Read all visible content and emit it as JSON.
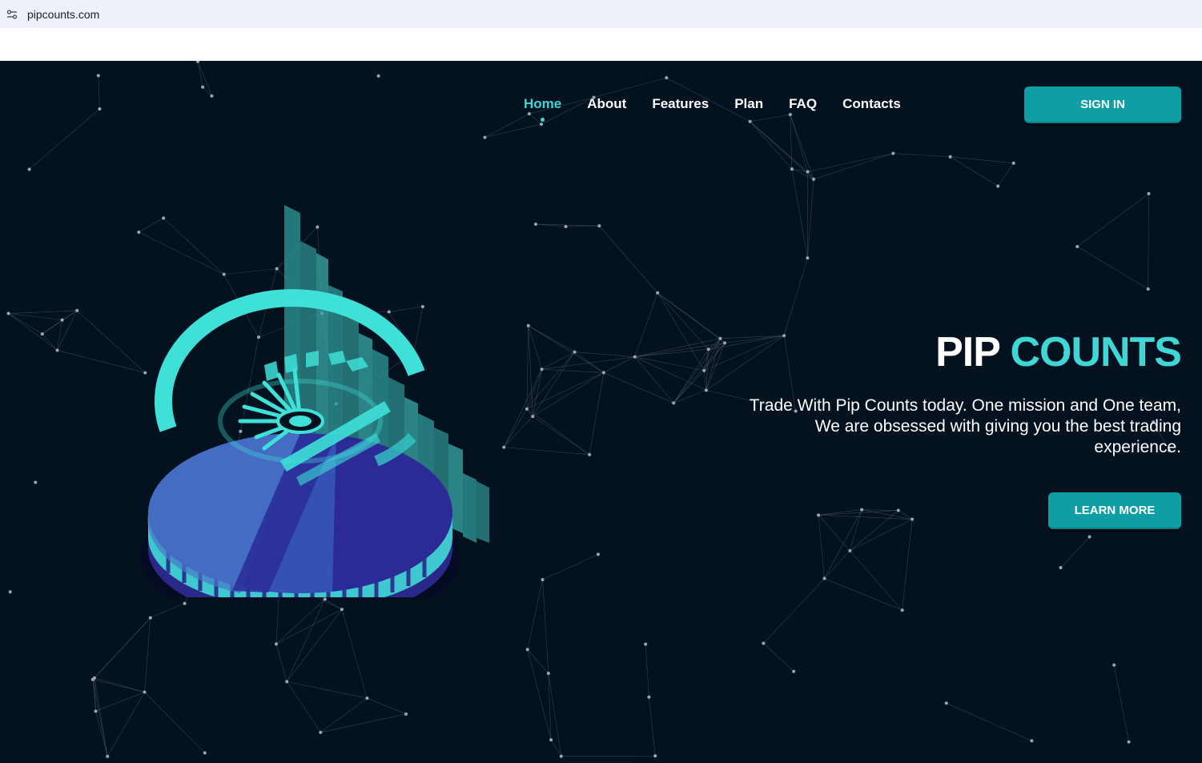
{
  "browser": {
    "url": "pipcounts.com"
  },
  "nav": {
    "items": [
      {
        "label": "Home",
        "active": true
      },
      {
        "label": "About",
        "active": false
      },
      {
        "label": "Features",
        "active": false
      },
      {
        "label": "Plan",
        "active": false
      },
      {
        "label": "FAQ",
        "active": false
      },
      {
        "label": "Contacts",
        "active": false
      }
    ],
    "sign_in_label": "SIGN IN"
  },
  "hero": {
    "title_white": "PIP",
    "title_accent": "COUNTS",
    "tagline": "Trade With Pip Counts today. One mission and One team, We are obsessed with giving you the best trading experience.",
    "cta_label": "LEARN MORE"
  },
  "colors": {
    "background": "#04111f",
    "accent": "#3fd6d6",
    "button": "#0f9ea3",
    "coin_top": "#3b4fb8",
    "coin_side": "#2a1f80"
  },
  "icons": {
    "site_settings": "tune-icon",
    "illustration": "coin-chart-illustration"
  }
}
